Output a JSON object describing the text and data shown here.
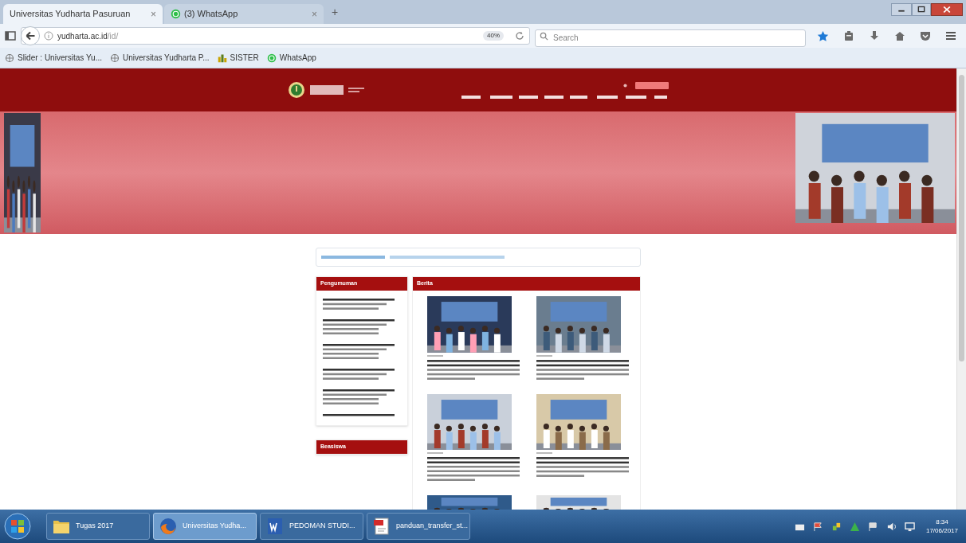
{
  "browser": {
    "tabs": [
      {
        "label": "Universitas Yudharta Pasuruan",
        "close": "×",
        "kind": "page",
        "selected": true
      },
      {
        "label": "(3) WhatsApp",
        "close": "×",
        "kind": "whatsapp",
        "selected": false
      }
    ],
    "new_tab": "+",
    "address": {
      "host": "yudharta.ac.id",
      "path": "/id/"
    },
    "zoom": "40%",
    "search": {
      "placeholder": "Search"
    },
    "bookmarks": [
      {
        "label": "Slider : Universitas Yu...",
        "kind": "globe"
      },
      {
        "label": "Universitas Yudharta P...",
        "kind": "globe"
      },
      {
        "label": "SISTER",
        "kind": "sister"
      },
      {
        "label": "WhatsApp",
        "kind": "whatsapp"
      }
    ]
  },
  "page": {
    "left_panels": [
      {
        "title": "Pengumuman"
      },
      {
        "title": "Beasiswa"
      }
    ],
    "news": {
      "title": "Berita"
    }
  },
  "taskbar": {
    "items": [
      {
        "label": "Tugas 2017",
        "kind": "folder",
        "selected": false
      },
      {
        "label": "Universitas Yudha...",
        "kind": "firefox",
        "selected": true
      },
      {
        "label": "PEDOMAN STUDI...",
        "kind": "word",
        "selected": false
      },
      {
        "label": "panduan_transfer_st...",
        "kind": "pdf",
        "selected": false
      }
    ],
    "time": "8:34",
    "date": "17/06/2017"
  }
}
